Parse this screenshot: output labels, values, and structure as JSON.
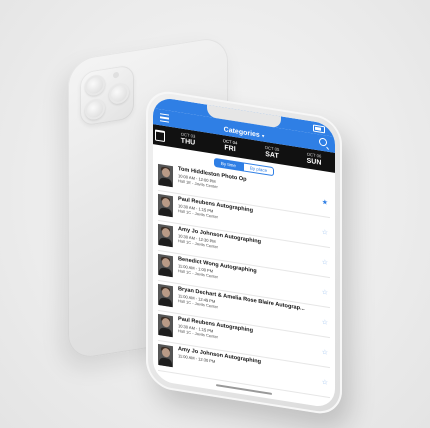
{
  "header": {
    "title": "Categories",
    "caret": "▾"
  },
  "days": [
    {
      "date": "OCT 03",
      "name": "THU"
    },
    {
      "date": "OCT 04",
      "name": "FRI"
    },
    {
      "date": "OCT 05",
      "name": "SAT"
    },
    {
      "date": "OCT 06",
      "name": "SUN"
    }
  ],
  "toggle": {
    "by_time": "By time",
    "by_place": "By place"
  },
  "events": [
    {
      "name": "Tom Hiddleston Photo Op",
      "time": "10:00 AM - 12:00 PM",
      "location": "Hall 1E - Javits Center",
      "starred": true
    },
    {
      "name": "Paul Reubens Autographing",
      "time": "10:30 AM - 1:15 PM",
      "location": "Hall 1C - Javits Center",
      "starred": false
    },
    {
      "name": "Amy Jo Johnson Autographing",
      "time": "10:30 AM - 12:30 PM",
      "location": "Hall 1C - Javits Center",
      "starred": false
    },
    {
      "name": "Benedict Wong Autographing",
      "time": "11:00 AM - 1:00 PM",
      "location": "Hall 1C - Javits Center",
      "starred": false
    },
    {
      "name": "Bryan Dechart & Amelia Rose Blaire Autograp...",
      "time": "11:00 AM - 12:45 PM",
      "location": "Hall 1C - Javits Center",
      "starred": false
    },
    {
      "name": "Paul Reubens Autographing",
      "time": "10:30 AM - 1:15 PM",
      "location": "Hall 1C - Javits Center",
      "starred": false
    },
    {
      "name": "Amy Jo Johnson Autographing",
      "time": "11:00 AM - 12:30 PM",
      "location": "",
      "starred": false
    }
  ],
  "icons": {
    "star": "★",
    "star_outline": "☆"
  },
  "colors": {
    "accent": "#2f7fe5",
    "day_strip": "#111111"
  }
}
